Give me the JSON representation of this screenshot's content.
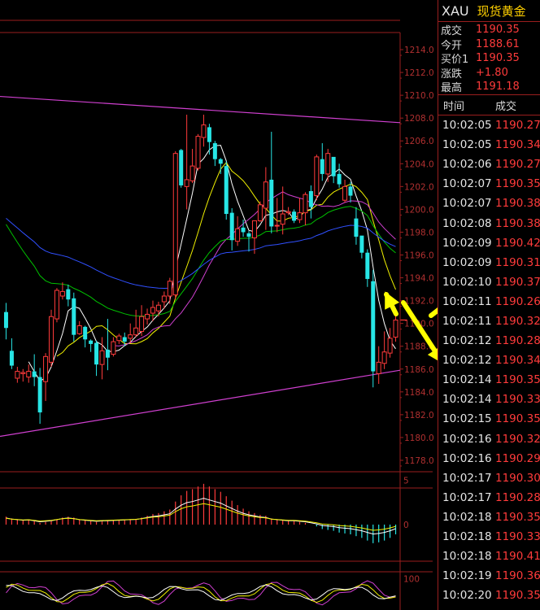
{
  "symbol": "XAU",
  "instrument_name": "现货黄金",
  "quote": [
    {
      "label": "成交",
      "value": "1190.35"
    },
    {
      "label": "今开",
      "value": "1188.61"
    },
    {
      "label": "买价1",
      "value": "1190.35"
    },
    {
      "label": "涨跌",
      "value": "+1.80"
    },
    {
      "label": "最高",
      "value": "1191.18"
    }
  ],
  "ticks_header": {
    "time": "时间",
    "price": "成交"
  },
  "ticks": [
    {
      "time": "10:02:05",
      "price": "1190.27"
    },
    {
      "time": "10:02:05",
      "price": "1190.34"
    },
    {
      "time": "10:02:06",
      "price": "1190.27"
    },
    {
      "time": "10:02:07",
      "price": "1190.35"
    },
    {
      "time": "10:02:07",
      "price": "1190.38"
    },
    {
      "time": "10:02:08",
      "price": "1190.38"
    },
    {
      "time": "10:02:09",
      "price": "1190.42"
    },
    {
      "time": "10:02:09",
      "price": "1190.31"
    },
    {
      "time": "10:02:10",
      "price": "1190.37"
    },
    {
      "time": "10:02:11",
      "price": "1190.26"
    },
    {
      "time": "10:02:11",
      "price": "1190.32"
    },
    {
      "time": "10:02:12",
      "price": "1190.28"
    },
    {
      "time": "10:02:12",
      "price": "1190.34"
    },
    {
      "time": "10:02:14",
      "price": "1190.35"
    },
    {
      "time": "10:02:14",
      "price": "1190.33"
    },
    {
      "time": "10:02:15",
      "price": "1190.35"
    },
    {
      "time": "10:02:16",
      "price": "1190.32"
    },
    {
      "time": "10:02:16",
      "price": "1190.29"
    },
    {
      "time": "10:02:17",
      "price": "1190.30"
    },
    {
      "time": "10:02:17",
      "price": "1190.28"
    },
    {
      "time": "10:02:18",
      "price": "1190.35"
    },
    {
      "time": "10:02:18",
      "price": "1190.33"
    },
    {
      "time": "10:02:18",
      "price": "1190.41"
    },
    {
      "time": "10:02:19",
      "price": "1190.36"
    },
    {
      "time": "10:02:20",
      "price": "1190.35"
    }
  ],
  "colors": {
    "up": "#ff3b3b",
    "down": "#27e5e5",
    "axis": "#9a1e1e",
    "label": "#b03030"
  },
  "chart_data": [
    {
      "type": "candlestick",
      "panel": "price",
      "ylim": [
        1177,
        1215.5
      ],
      "yticks": [
        1178.0,
        1180.0,
        1182.0,
        1184.0,
        1186.0,
        1188.0,
        1190.0,
        1192.0,
        1194.0,
        1196.0,
        1198.0,
        1200.0,
        1202.0,
        1204.0,
        1206.0,
        1208.0,
        1210.0,
        1212.0,
        1214.0
      ],
      "x_count": 61,
      "candles": [
        [
          1191.0,
          1189.6,
          1188.6,
          1191.8
        ],
        [
          1187.6,
          1186.3,
          1186.0,
          1188.7
        ],
        [
          1185.2,
          1185.8,
          1184.8,
          1186.2
        ],
        [
          1185.6,
          1185.7,
          1184.9,
          1186.0
        ],
        [
          1185.3,
          1185.8,
          1184.8,
          1186.4
        ],
        [
          1185.8,
          1185.3,
          1184.5,
          1187.3
        ],
        [
          1185.3,
          1182.2,
          1181.2,
          1186.1
        ],
        [
          1184.9,
          1187.1,
          1183.2,
          1187.4
        ],
        [
          1186.6,
          1190.6,
          1186.2,
          1191.2
        ],
        [
          1190.4,
          1192.9,
          1190.1,
          1193.1
        ],
        [
          1192.4,
          1192.8,
          1192.1,
          1193.6
        ],
        [
          1193.0,
          1192.1,
          1191.5,
          1193.4
        ],
        [
          1192.2,
          1189.0,
          1188.4,
          1192.7
        ],
        [
          1189.1,
          1189.8,
          1189.0,
          1190.2
        ],
        [
          1189.7,
          1188.6,
          1187.9,
          1189.8
        ],
        [
          1188.5,
          1188.2,
          1187.5,
          1188.6
        ],
        [
          1188.3,
          1186.4,
          1185.4,
          1188.5
        ],
        [
          1186.4,
          1187.6,
          1185.1,
          1188.8
        ],
        [
          1187.7,
          1187.0,
          1185.9,
          1190.4
        ],
        [
          1187.3,
          1188.4,
          1187.1,
          1188.8
        ],
        [
          1188.5,
          1188.9,
          1188.2,
          1189.1
        ],
        [
          1188.8,
          1188.4,
          1188.0,
          1189.2
        ],
        [
          1188.7,
          1189.0,
          1188.3,
          1190.0
        ],
        [
          1189.0,
          1189.6,
          1188.8,
          1191.2
        ],
        [
          1189.3,
          1190.6,
          1188.9,
          1191.6
        ],
        [
          1190.4,
          1190.8,
          1189.9,
          1191.3
        ],
        [
          1190.9,
          1191.4,
          1190.2,
          1192.0
        ],
        [
          1191.1,
          1191.6,
          1190.6,
          1191.9
        ],
        [
          1191.9,
          1192.4,
          1191.3,
          1192.8
        ],
        [
          1192.4,
          1193.7,
          1191.7,
          1194.0
        ],
        [
          1192.5,
          1204.9,
          1192.1,
          1205.1
        ],
        [
          1205.2,
          1202.1,
          1201.9,
          1205.3
        ],
        [
          1202.0,
          1202.6,
          1200.0,
          1208.3
        ],
        [
          1202.5,
          1203.8,
          1202.3,
          1205.3
        ],
        [
          1203.6,
          1206.4,
          1203.4,
          1206.6
        ],
        [
          1206.3,
          1207.4,
          1205.5,
          1208.3
        ],
        [
          1207.2,
          1205.9,
          1204.8,
          1207.5
        ],
        [
          1205.8,
          1204.4,
          1203.8,
          1206.0
        ],
        [
          1204.4,
          1204.0,
          1203.1,
          1204.5
        ],
        [
          1203.8,
          1199.6,
          1199.1,
          1204.2
        ],
        [
          1199.7,
          1197.3,
          1196.4,
          1200.1
        ],
        [
          1197.2,
          1198.3,
          1196.8,
          1199.4
        ],
        [
          1198.4,
          1198.0,
          1197.6,
          1199.1
        ],
        [
          1197.9,
          1197.6,
          1196.3,
          1198.1
        ],
        [
          1197.5,
          1199.0,
          1196.1,
          1198.6
        ],
        [
          1199.0,
          1200.4,
          1198.9,
          1200.7
        ],
        [
          1200.1,
          1202.4,
          1198.2,
          1203.7
        ],
        [
          1202.6,
          1198.5,
          1197.9,
          1206.8
        ],
        [
          1198.6,
          1198.6,
          1198.0,
          1201.0
        ],
        [
          1198.7,
          1199.6,
          1197.8,
          1202.0
        ],
        [
          1199.7,
          1199.8,
          1199.5,
          1200.2
        ],
        [
          1199.8,
          1199.0,
          1198.8,
          1200.0
        ],
        [
          1199.1,
          1199.7,
          1198.8,
          1201.0
        ],
        [
          1199.7,
          1201.3,
          1198.6,
          1201.5
        ],
        [
          1201.6,
          1200.2,
          1199.2,
          1202.1
        ],
        [
          1201.2,
          1204.6,
          1200.8,
          1204.8
        ],
        [
          1204.4,
          1203.1,
          1202.5,
          1205.8
        ],
        [
          1203.1,
          1204.9,
          1202.4,
          1205.3
        ],
        [
          1204.6,
          1202.9,
          1202.3,
          1204.2
        ],
        [
          1203.1,
          1202.2,
          1201.9,
          1204.0
        ],
        [
          1200.8,
          1202.0,
          1200.6,
          1202.6
        ],
        [
          1202.0,
          1201.2,
          1200.6,
          1202.4
        ],
        [
          1199.2,
          1197.6,
          1196.9,
          1200.2
        ],
        [
          1197.7,
          1196.2,
          1195.7,
          1197.6
        ],
        [
          1196.2,
          1193.9,
          1193.2,
          1196.5
        ],
        [
          1193.7,
          1185.8,
          1184.4,
          1194.7
        ],
        [
          1185.6,
          1186.6,
          1184.7,
          1188.0
        ],
        [
          1186.5,
          1187.5,
          1186.0,
          1189.3
        ],
        [
          1187.4,
          1188.7,
          1187.0,
          1189.6
        ],
        [
          1188.8,
          1190.3,
          1188.4,
          1191.2
        ]
      ]
    },
    {
      "type": "bar",
      "panel": "macd",
      "ylim": [
        -2.4,
        5.4
      ],
      "yticks": [
        0,
        5
      ],
      "values": [
        0.9,
        0.7,
        0.6,
        0.5,
        0.55,
        0.4,
        0.2,
        0.3,
        0.4,
        0.6,
        0.8,
        0.9,
        0.8,
        0.6,
        0.5,
        0.4,
        0.3,
        0.35,
        0.4,
        0.45,
        0.5,
        0.55,
        0.6,
        0.65,
        0.8,
        1.0,
        1.2,
        1.3,
        1.5,
        1.7,
        2.6,
        3.3,
        3.8,
        4.0,
        4.3,
        4.6,
        4.3,
        4.0,
        3.7,
        3.2,
        2.7,
        2.2,
        1.8,
        1.5,
        1.3,
        1.1,
        1.0,
        0.7,
        0.6,
        0.5,
        0.4,
        0.4,
        0.3,
        0.2,
        0.0,
        -0.2,
        -0.5,
        -0.6,
        -0.7,
        -0.9,
        -1.0,
        -1.1,
        -1.3,
        -1.5,
        -1.8,
        -2.1,
        -2.0,
        -1.8,
        -1.5,
        -1.1
      ]
    },
    {
      "type": "line",
      "panel": "oscillator",
      "ylim": [
        0,
        110
      ],
      "yticks": [
        100
      ]
    }
  ]
}
